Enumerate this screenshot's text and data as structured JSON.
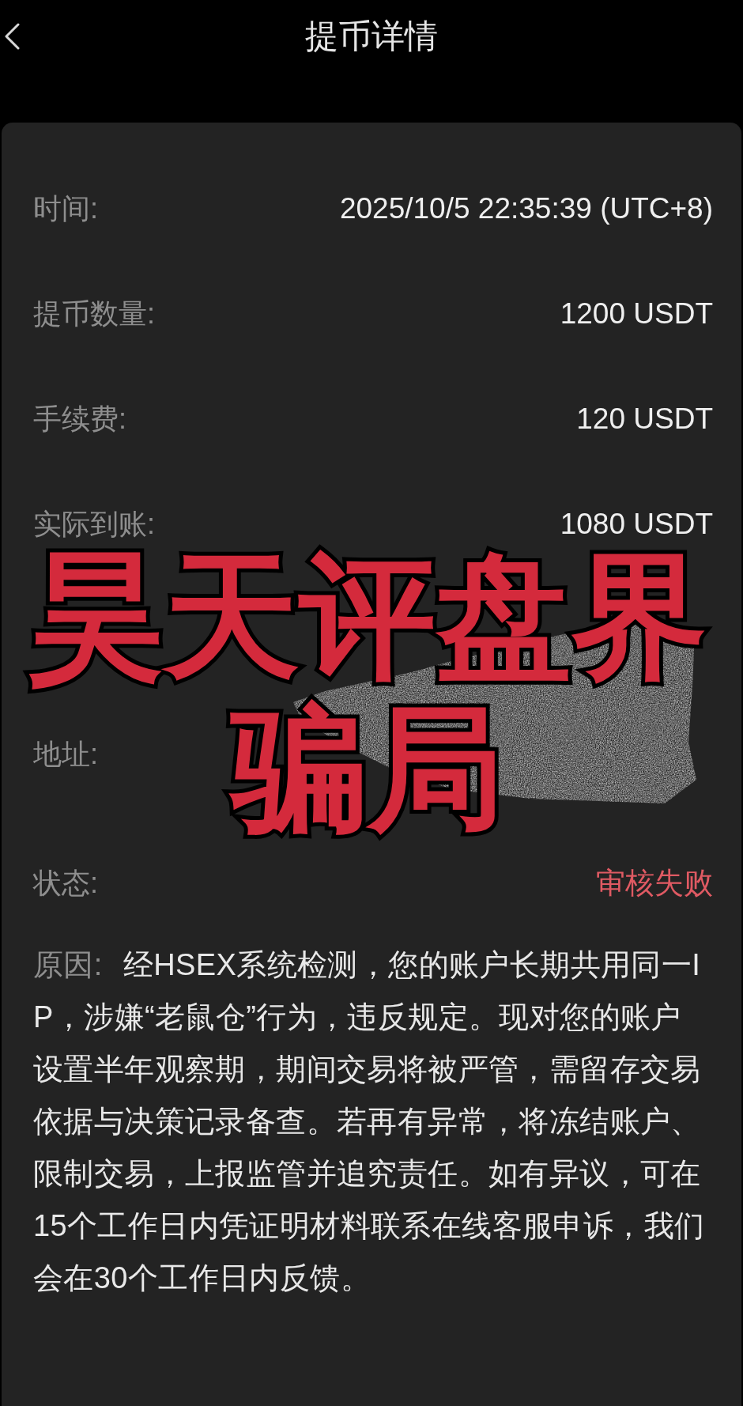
{
  "header": {
    "title": "提币详情"
  },
  "details": [
    {
      "kind": "text",
      "label": "时间:",
      "value": "2025/10/5 22:35:39 (UTC+8)"
    },
    {
      "kind": "text",
      "label": "提币数量:",
      "value": "1200 USDT"
    },
    {
      "kind": "text",
      "label": "手续费:",
      "value": "120 USDT"
    },
    {
      "kind": "text",
      "label": "实际到账:",
      "value": "1080 USDT"
    },
    {
      "kind": "redacted",
      "label": "地址:"
    },
    {
      "kind": "status",
      "label": "状态:",
      "value": "审核失败"
    }
  ],
  "reason": {
    "label": "原因:",
    "text": "经HSEX系统检测，您的账户长期共用同一IP，涉嫌“老鼠仓”行为，违反规定。现对您的账户设置半年观察期，期间交易将被严管，需留存交易依据与决策记录备查。若再有异常，将冻结账户、限制交易，上报监管并追究责任。如有异议，可在15个工作日内凭证明材料联系在线客服申诉，我们会在30个工作日内反馈。"
  },
  "overlay_caption": [
    "昊天评盘界",
    "骗局"
  ]
}
